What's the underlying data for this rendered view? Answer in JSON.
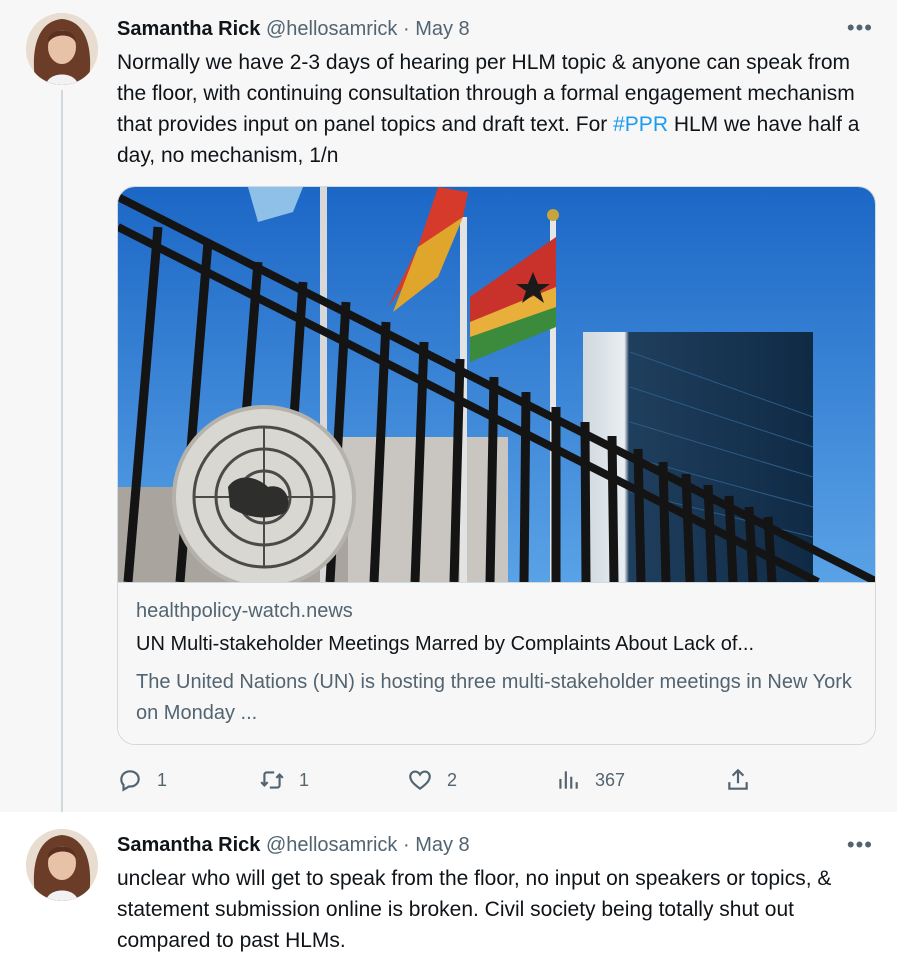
{
  "tweets": [
    {
      "author_name": "Samantha Rick",
      "handle": "@hellosamrick",
      "separator": "·",
      "date": "May 8",
      "more_label": "•••",
      "text_main": "Normally we have 2-3 days of hearing per HLM topic & anyone can speak from the floor, with continuing consultation through a formal engagement mechanism that provides input on panel topics and draft text. For ",
      "hashtag": "#PPR",
      "text_tail": " HLM we have half a day, no mechanism, 1/n",
      "card": {
        "domain": "healthpolicy-watch.news",
        "title": "UN Multi-stakeholder Meetings Marred by Complaints About Lack of...",
        "description": "The United Nations (UN) is hosting three multi-stakeholder meetings in New York on Monday ..."
      },
      "actions": {
        "reply_count": "1",
        "retweet_count": "1",
        "like_count": "2",
        "views_count": "367"
      }
    },
    {
      "author_name": "Samantha Rick",
      "handle": "@hellosamrick",
      "separator": "·",
      "date": "May 8",
      "more_label": "•••",
      "text": "unclear who will get to speak from the floor, no input on speakers or topics, & statement submission online is broken. Civil society being totally shut out compared to past HLMs."
    }
  ],
  "colors": {
    "link": "#1d9bf0",
    "secondary_text": "#536471",
    "primary_text": "#0f1419"
  }
}
